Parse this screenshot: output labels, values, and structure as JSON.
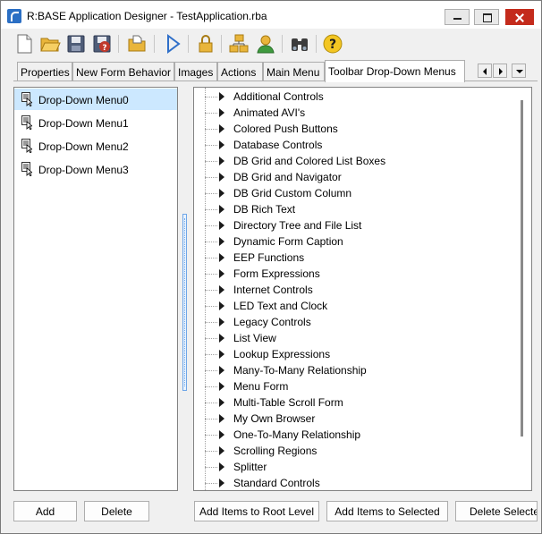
{
  "window": {
    "title": "R:BASE Application Designer - TestApplication.rba"
  },
  "toolbar": {
    "icons": [
      "new-document-icon",
      "open-folder-icon",
      "save-disk-icon",
      "help-disk-icon",
      "open-file-icon",
      "run-play-icon",
      "lock-icon",
      "network-icon",
      "user-icon",
      "binoculars-icon",
      "help-icon"
    ]
  },
  "tabs": [
    {
      "label": "Properties"
    },
    {
      "label": "New Form Behavior"
    },
    {
      "label": "Images"
    },
    {
      "label": "Actions"
    },
    {
      "label": "Main Menu"
    },
    {
      "label": "Toolbar Drop-Down Menus"
    }
  ],
  "dropdown_menus": [
    {
      "label": "Drop-Down Menu0",
      "selected": true
    },
    {
      "label": "Drop-Down Menu1",
      "selected": false
    },
    {
      "label": "Drop-Down Menu2",
      "selected": false
    },
    {
      "label": "Drop-Down Menu3",
      "selected": false
    }
  ],
  "tree_items": [
    {
      "label": "Additional Controls"
    },
    {
      "label": "Animated AVI's"
    },
    {
      "label": "Colored Push Buttons"
    },
    {
      "label": "Database Controls"
    },
    {
      "label": "DB Grid and Colored List Boxes"
    },
    {
      "label": "DB Grid and Navigator"
    },
    {
      "label": "DB Grid Custom Column"
    },
    {
      "label": "DB Rich Text"
    },
    {
      "label": "Directory Tree and File List"
    },
    {
      "label": "Dynamic Form Caption"
    },
    {
      "label": "EEP Functions"
    },
    {
      "label": "Form Expressions"
    },
    {
      "label": "Internet Controls"
    },
    {
      "label": "LED Text and Clock"
    },
    {
      "label": "Legacy Controls"
    },
    {
      "label": "List View"
    },
    {
      "label": "Lookup Expressions"
    },
    {
      "label": "Many-To-Many Relationship"
    },
    {
      "label": "Menu Form"
    },
    {
      "label": "Multi-Table Scroll Form"
    },
    {
      "label": "My Own Browser"
    },
    {
      "label": "One-To-Many Relationship"
    },
    {
      "label": "Scrolling Regions"
    },
    {
      "label": "Splitter"
    },
    {
      "label": "Standard Controls"
    }
  ],
  "buttons": {
    "add": "Add",
    "delete": "Delete",
    "add_root": "Add Items to Root Level",
    "add_selected": "Add Items to Selected",
    "delete_selected": "Delete Selected"
  },
  "colors": {
    "selection": "#cce8ff",
    "close_button": "#c42b1c",
    "splitter": "#6ea6e8"
  }
}
